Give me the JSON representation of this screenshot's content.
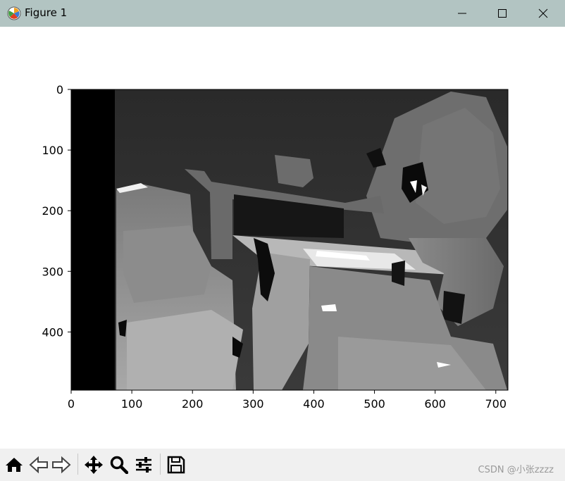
{
  "window": {
    "title": "Figure 1",
    "titlebar_color": "#b2c4c2",
    "controls": [
      "minimize-icon",
      "maximize-icon",
      "close-icon"
    ]
  },
  "chart_data": {
    "type": "heatmap",
    "description_kind": "grayscale depth image (imshow)",
    "colormap": "gray",
    "x": {
      "lim": [
        0,
        720
      ],
      "ticks": [
        0,
        100,
        200,
        300,
        400,
        500,
        600,
        700
      ]
    },
    "y": {
      "lim": [
        0,
        496
      ],
      "inverted": true,
      "ticks": [
        0,
        100,
        200,
        300,
        400
      ]
    },
    "grid": false,
    "legend": "none"
  },
  "toolbar": {
    "buttons": [
      "home-icon",
      "back-icon",
      "forward-icon",
      "pan-icon",
      "zoom-icon",
      "configure-subplots-icon",
      "save-icon"
    ]
  },
  "watermark": "CSDN @小张zzzz"
}
